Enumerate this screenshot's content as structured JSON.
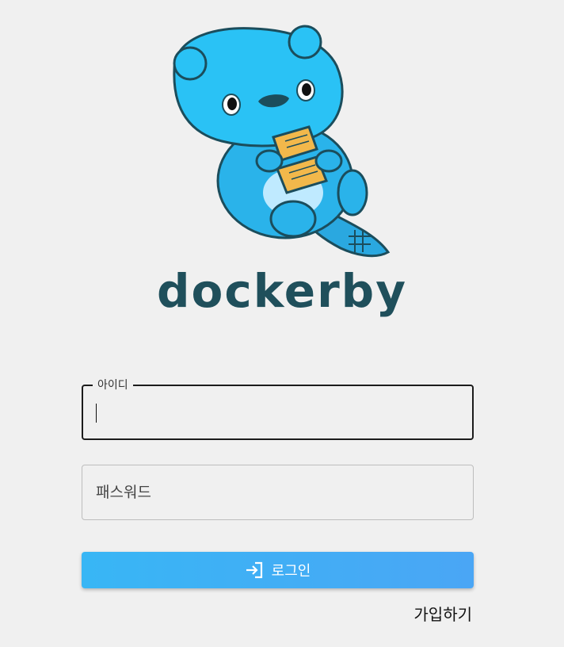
{
  "brand": {
    "name": "dockerby",
    "text_color": "#1f4f5b"
  },
  "login_form": {
    "id_field": {
      "label": "아이디",
      "value": ""
    },
    "password_field": {
      "placeholder": "패스워드",
      "value": ""
    },
    "login_button": {
      "label": "로그인",
      "icon": "login-icon",
      "color": "#38b6f5"
    },
    "signup_link": {
      "label": "가입하기"
    }
  }
}
